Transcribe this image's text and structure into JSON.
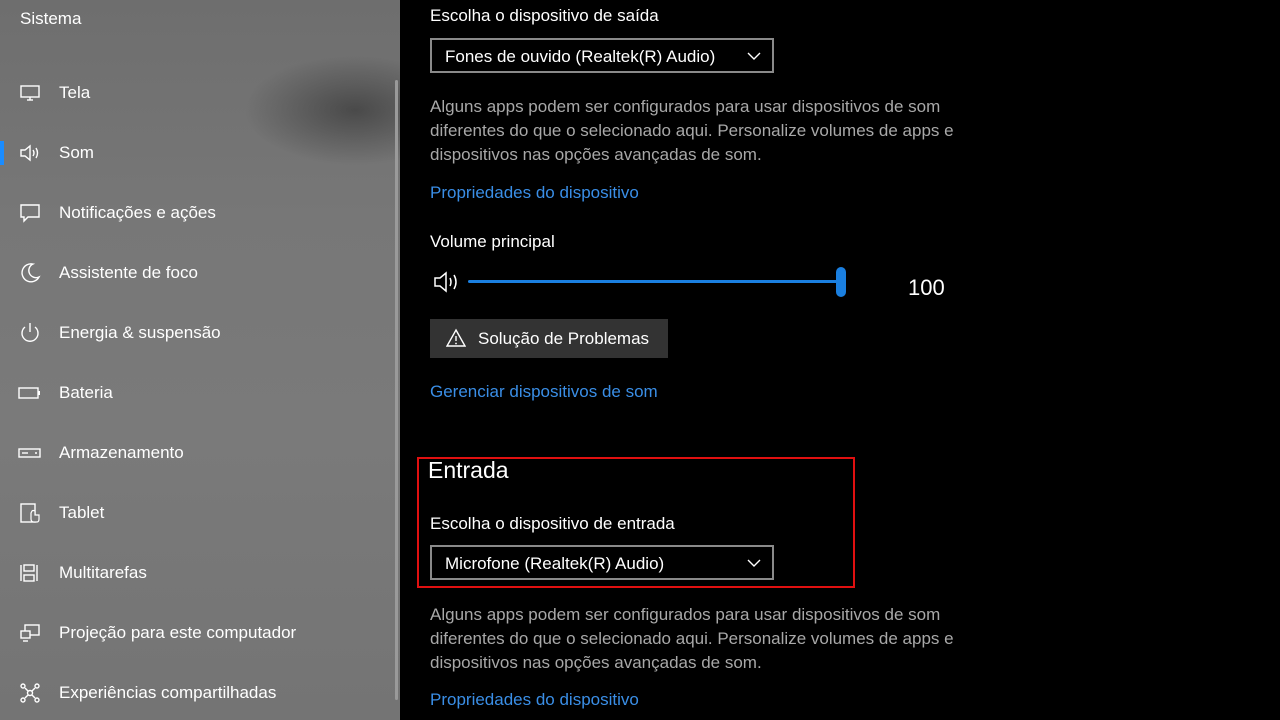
{
  "sidebar": {
    "title": "Sistema",
    "items": [
      {
        "label": "Tela",
        "icon": "monitor-icon"
      },
      {
        "label": "Som",
        "icon": "speaker-icon",
        "active": true
      },
      {
        "label": "Notificações e ações",
        "icon": "notification-icon"
      },
      {
        "label": "Assistente de foco",
        "icon": "moon-icon"
      },
      {
        "label": "Energia & suspensão",
        "icon": "power-icon"
      },
      {
        "label": "Bateria",
        "icon": "battery-icon"
      },
      {
        "label": "Armazenamento",
        "icon": "storage-icon"
      },
      {
        "label": "Tablet",
        "icon": "tablet-icon"
      },
      {
        "label": "Multitarefas",
        "icon": "multitask-icon"
      },
      {
        "label": "Projeção para este computador",
        "icon": "projection-icon"
      },
      {
        "label": "Experiências compartilhadas",
        "icon": "shared-icon"
      }
    ]
  },
  "output": {
    "choose_label": "Escolha o dispositivo de saída",
    "selected_device": "Fones de ouvido (Realtek(R) Audio)",
    "description": "Alguns apps podem ser configurados para usar dispositivos de som diferentes do que o selecionado aqui. Personalize volumes de apps e dispositivos nas opções avançadas de som.",
    "properties_link": "Propriedades do dispositivo",
    "volume_label": "Volume principal",
    "volume_value": "100",
    "troubleshoot_label": "Solução de Problemas",
    "manage_link": "Gerenciar dispositivos de som"
  },
  "input": {
    "section_title": "Entrada",
    "choose_label": "Escolha o dispositivo de entrada",
    "selected_device": "Microfone (Realtek(R) Audio)",
    "description": "Alguns apps podem ser configurados para usar dispositivos de som diferentes do que o selecionado aqui. Personalize volumes de apps e dispositivos nas opções avançadas de som.",
    "properties_link": "Propriedades do dispositivo"
  },
  "colors": {
    "accent": "#1a7fe0",
    "link": "#3a8ee6",
    "highlight": "#e01010"
  }
}
